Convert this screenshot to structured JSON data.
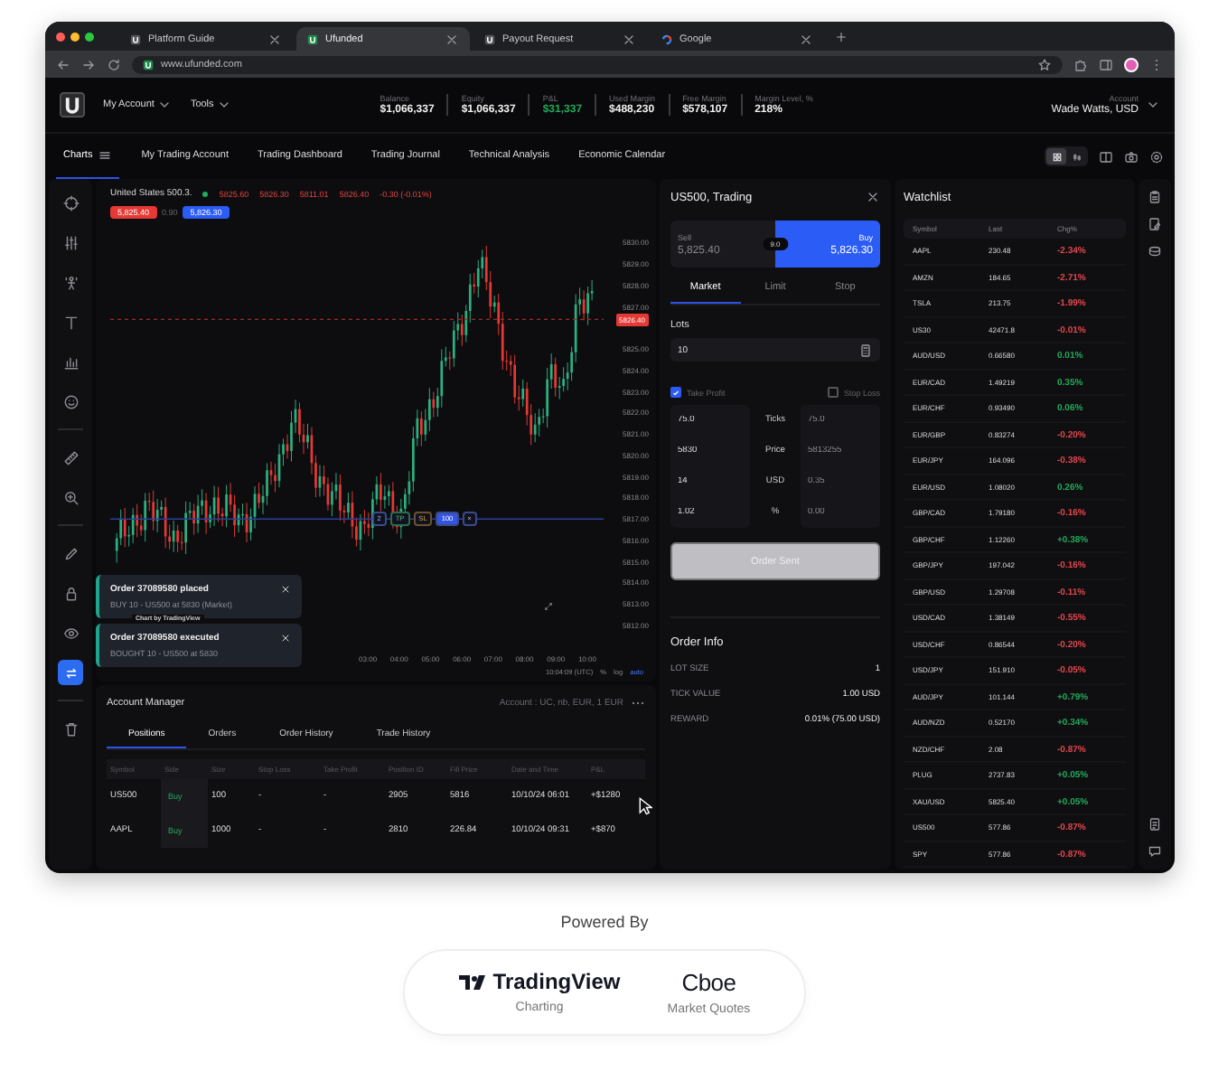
{
  "browser": {
    "tabs": [
      {
        "title": "Platform Guide",
        "selected": false,
        "kind": "site"
      },
      {
        "title": "Ufunded",
        "selected": true,
        "kind": "site"
      },
      {
        "title": "Payout Request",
        "selected": false,
        "kind": "site"
      },
      {
        "title": "Google",
        "selected": false,
        "kind": "search"
      }
    ],
    "url": "www.ufunded.com"
  },
  "header": {
    "menus": [
      "My Account",
      "Tools"
    ],
    "stats": [
      {
        "label": "Balance",
        "value": "$1,066,337",
        "color": "#f2f2f2"
      },
      {
        "label": "Equity",
        "value": "$1,066,337",
        "color": "#f2f2f2"
      },
      {
        "label": "P&L",
        "value": "$31,337",
        "color": "#22ab5a"
      },
      {
        "label": "Used Margin",
        "value": "$488,230",
        "color": "#f2f2f2"
      },
      {
        "label": "Free Margin",
        "value": "$578,107",
        "color": "#f2f2f2"
      },
      {
        "label": "Margin Level, %",
        "value": "218%",
        "color": "#f2f2f2"
      }
    ],
    "account": {
      "label": "Account",
      "value": "Wade Watts, USD"
    }
  },
  "nav": {
    "tabs": [
      {
        "label": "Charts",
        "selected": true
      },
      {
        "label": "My Trading Account",
        "selected": false
      },
      {
        "label": "Trading Dashboard",
        "selected": false
      },
      {
        "label": "Trading Journal",
        "selected": false
      },
      {
        "label": "Technical Analysis",
        "selected": false
      },
      {
        "label": "Economic Calendar",
        "selected": false
      }
    ],
    "layout_toggles": [
      {
        "selected": true
      },
      {
        "selected": false
      }
    ]
  },
  "toolbar": {
    "tools": [
      {
        "selected": false
      },
      {
        "selected": false
      },
      {
        "selected": false
      },
      {
        "selected": false
      },
      {
        "selected": false
      },
      {
        "selected": false
      },
      {
        "selected": false
      },
      {
        "selected": false
      },
      {
        "selected": false
      },
      {
        "selected": false
      },
      {
        "selected": false
      },
      {
        "selected": true
      },
      {
        "selected": false
      }
    ]
  },
  "chart": {
    "symbol": "United States 500.3.",
    "quotes": [
      "5825.60",
      "5826.30",
      "5811.01",
      "5826.40",
      "-0.30 (-0.01%)"
    ],
    "sell_tag": "5,825.40",
    "spread": "0.90",
    "buy_tag": "5,826.30",
    "price_axis": [
      {
        "label": "5830.00",
        "highlight": false
      },
      {
        "label": "5829.00",
        "highlight": false
      },
      {
        "label": "5828.00",
        "highlight": false
      },
      {
        "label": "5827.00",
        "highlight": false
      },
      {
        "label": "5826.40",
        "highlight": true
      },
      {
        "label": "5825.00",
        "highlight": false
      },
      {
        "label": "5824.00",
        "highlight": false
      },
      {
        "label": "5823.00",
        "highlight": false
      },
      {
        "label": "5822.00",
        "highlight": false
      },
      {
        "label": "5821.00",
        "highlight": false
      },
      {
        "label": "5820.00",
        "highlight": false
      },
      {
        "label": "5819.00",
        "highlight": false
      },
      {
        "label": "5818.00",
        "highlight": false
      },
      {
        "label": "5817.00",
        "highlight": false
      },
      {
        "label": "5816.00",
        "highlight": false
      },
      {
        "label": "5815.00",
        "highlight": false
      },
      {
        "label": "5814.00",
        "highlight": false
      },
      {
        "label": "5813.00",
        "highlight": false
      },
      {
        "label": "5812.00",
        "highlight": false
      }
    ],
    "time_axis": [
      "03:00",
      "04:00",
      "05:00",
      "06:00",
      "07:00",
      "08:00",
      "09:00",
      "10:00"
    ],
    "order_line": {
      "tags": [
        {
          "label": "2",
          "kind": "count"
        },
        {
          "label": "TP",
          "kind": "tp"
        },
        {
          "label": "SL",
          "kind": "sl"
        },
        {
          "label": "100",
          "kind": "size"
        },
        {
          "label": "×",
          "kind": "close"
        }
      ]
    },
    "attribution": "Chart by TradingView",
    "footer": [
      "10:04:09 (UTC)",
      "%",
      "log",
      "auto"
    ]
  },
  "notifications": [
    {
      "title": "Order 37089580 placed",
      "body": "BUY 10 - US500 at 5830 (Market)"
    },
    {
      "title": "Order 37089580 executed",
      "body": "BOUGHT 10 - US500 at 5830"
    }
  ],
  "account_manager": {
    "title": "Account Manager",
    "account": "Account : UC, nb, EUR, 1 EUR",
    "tabs": [
      {
        "label": "Positions",
        "selected": true
      },
      {
        "label": "Orders",
        "selected": false
      },
      {
        "label": "Order History",
        "selected": false
      },
      {
        "label": "Trade History",
        "selected": false
      }
    ],
    "columns": [
      "Symbol",
      "Side",
      "Size",
      "Stop Loss",
      "Take Profit",
      "Position ID",
      "Fill Price",
      "Date and Time",
      "P&L"
    ],
    "rows": [
      {
        "symbol": "US500",
        "side": "Buy",
        "size": "100",
        "stop_loss": "-",
        "take_profit": "-",
        "position_id": "2905",
        "fill_price": "5816",
        "date_time": "10/10/24 06:01",
        "pnl": "+$1280"
      },
      {
        "symbol": "AAPL",
        "side": "Buy",
        "size": "1000",
        "stop_loss": "-",
        "take_profit": "-",
        "position_id": "2810",
        "fill_price": "226.84",
        "date_time": "10/10/24 09:31",
        "pnl": "+$870"
      }
    ]
  },
  "trade_panel": {
    "title": "US500, Trading",
    "sell": {
      "label": "Sell",
      "price": "5,825.40",
      "selected": false
    },
    "buy": {
      "label": "Buy",
      "price": "5,826.30",
      "selected": true
    },
    "spread": "9.0",
    "order_tabs": [
      {
        "label": "Market",
        "selected": true
      },
      {
        "label": "Limit",
        "selected": false
      },
      {
        "label": "Stop",
        "selected": false
      }
    ],
    "lots": {
      "label": "Lots",
      "value": "10"
    },
    "take_profit": {
      "label": "Take Profit",
      "checked": true
    },
    "stop_loss": {
      "label": "Stop Loss",
      "checked": false
    },
    "rows": [
      {
        "tp": "75.0",
        "unit": "Ticks",
        "sl": "75.0"
      },
      {
        "tp": "5830",
        "unit": "Price",
        "sl": "5813255"
      },
      {
        "tp": "14",
        "unit": "USD",
        "sl": "0.35"
      },
      {
        "tp": "1.02",
        "unit": "%",
        "sl": "0.00"
      }
    ],
    "submit": {
      "label": "Order Sent",
      "disabled": true
    },
    "info_title": "Order Info",
    "info": [
      {
        "label": "LOT SIZE",
        "value": "1"
      },
      {
        "label": "TICK VALUE",
        "value": "1.00 USD"
      },
      {
        "label": "REWARD",
        "value": "0.01% (75.00 USD)"
      }
    ]
  },
  "watchlist": {
    "title": "Watchlist",
    "columns": [
      "Symbol",
      "Last",
      "Chg%"
    ],
    "rows": [
      {
        "symbol": "AAPL",
        "last": "230.48",
        "change": "-2.34%",
        "color": "#e5484d"
      },
      {
        "symbol": "AMZN",
        "last": "184.65",
        "change": "-2.71%",
        "color": "#e5484d"
      },
      {
        "symbol": "TSLA",
        "last": "213.75",
        "change": "-1.99%",
        "color": "#e5484d"
      },
      {
        "symbol": "US30",
        "last": "42471.8",
        "change": "-0.01%",
        "color": "#e5484d"
      },
      {
        "symbol": "AUD/USD",
        "last": "0.66580",
        "change": "0.01%",
        "color": "#22ab5a"
      },
      {
        "symbol": "EUR/CAD",
        "last": "1.49219",
        "change": "0.35%",
        "color": "#22ab5a"
      },
      {
        "symbol": "EUR/CHF",
        "last": "0.93490",
        "change": "0.06%",
        "color": "#22ab5a"
      },
      {
        "symbol": "EUR/GBP",
        "last": "0.83274",
        "change": "-0.20%",
        "color": "#e5484d"
      },
      {
        "symbol": "EUR/JPY",
        "last": "164.096",
        "change": "-0.38%",
        "color": "#e5484d"
      },
      {
        "symbol": "EUR/USD",
        "last": "1.08020",
        "change": "0.26%",
        "color": "#22ab5a"
      },
      {
        "symbol": "GBP/CAD",
        "last": "1.79180",
        "change": "-0.16%",
        "color": "#e5484d"
      },
      {
        "symbol": "GBP/CHF",
        "last": "1.12260",
        "change": "+0.38%",
        "color": "#22ab5a"
      },
      {
        "symbol": "GBP/JPY",
        "last": "197.042",
        "change": "-0.16%",
        "color": "#e5484d"
      },
      {
        "symbol": "GBP/USD",
        "last": "1.29708",
        "change": "-0.11%",
        "color": "#e5484d"
      },
      {
        "symbol": "USD/CAD",
        "last": "1.38149",
        "change": "-0.55%",
        "color": "#e5484d"
      },
      {
        "symbol": "USD/CHF",
        "last": "0.86544",
        "change": "-0.20%",
        "color": "#e5484d"
      },
      {
        "symbol": "USD/JPY",
        "last": "151.910",
        "change": "-0.05%",
        "color": "#e5484d"
      },
      {
        "symbol": "AUD/JPY",
        "last": "101.144",
        "change": "+0.79%",
        "color": "#22ab5a"
      },
      {
        "symbol": "AUD/NZD",
        "last": "0.52170",
        "change": "+0.34%",
        "color": "#22ab5a"
      },
      {
        "symbol": "NZD/CHF",
        "last": "2.08",
        "change": "-0.87%",
        "color": "#e5484d"
      },
      {
        "symbol": "PLUG",
        "last": "2737.83",
        "change": "+0.05%",
        "color": "#22ab5a"
      },
      {
        "symbol": "XAU/USD",
        "last": "5825.40",
        "change": "+0.05%",
        "color": "#22ab5a"
      },
      {
        "symbol": "US500",
        "last": "577.86",
        "change": "-0.87%",
        "color": "#e5484d"
      },
      {
        "symbol": "SPY",
        "last": "577.86",
        "change": "-0.87%",
        "color": "#e5484d"
      }
    ]
  },
  "footer": {
    "powered_by": "Powered By",
    "partners": [
      {
        "name": "TradingView",
        "caption": "Charting",
        "kind": "tradingview"
      },
      {
        "name": "Cboe",
        "caption": "Market Quotes",
        "kind": "cboe"
      }
    ]
  }
}
